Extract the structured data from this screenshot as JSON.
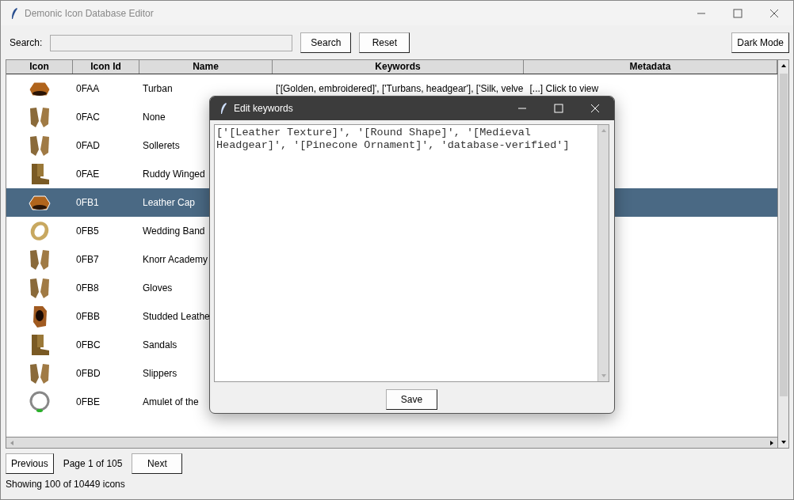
{
  "window": {
    "title": "Demonic Icon Database Editor"
  },
  "toolbar": {
    "search_label": "Search:",
    "search_button": "Search",
    "reset_button": "Reset",
    "dark_mode_button": "Dark Mode"
  },
  "table": {
    "columns": [
      "Icon",
      "Icon Id",
      "Name",
      "Keywords",
      "Metadata"
    ],
    "rows": [
      {
        "kind": "hat",
        "icon_id": "0FAA",
        "name": "Turban",
        "keywords": "['[Golden, embroidered]', ['Turbans, headgear'], ['Silk, velve",
        "keywords_link": "[...] Click to view",
        "selected": false
      },
      {
        "kind": "gloves",
        "icon_id": "0FAC",
        "name": "None",
        "selected": false
      },
      {
        "kind": "gloves",
        "icon_id": "0FAD",
        "name": "Sollerets",
        "selected": false
      },
      {
        "kind": "boots",
        "icon_id": "0FAE",
        "name": "Ruddy Winged",
        "selected": false
      },
      {
        "kind": "hat",
        "icon_id": "0FB1",
        "name": "Leather Cap",
        "selected": true
      },
      {
        "kind": "ring",
        "icon_id": "0FB5",
        "name": "Wedding Band",
        "selected": false
      },
      {
        "kind": "gloves",
        "icon_id": "0FB7",
        "name": "Knorr Academy",
        "selected": false
      },
      {
        "kind": "gloves",
        "icon_id": "0FB8",
        "name": "Gloves",
        "selected": false
      },
      {
        "kind": "vest",
        "icon_id": "0FBB",
        "name": "Studded Leathe",
        "selected": false
      },
      {
        "kind": "boots",
        "icon_id": "0FBC",
        "name": "Sandals",
        "selected": false
      },
      {
        "kind": "gloves",
        "icon_id": "0FBD",
        "name": "Slippers",
        "selected": false
      },
      {
        "kind": "amulet",
        "icon_id": "0FBE",
        "name": "Amulet of the",
        "selected": false
      }
    ]
  },
  "pagination": {
    "previous": "Previous",
    "page": "Page 1 of 105",
    "next": "Next"
  },
  "status_bar": "Showing 100 of 10449 icons",
  "dialog": {
    "title": "Edit keywords",
    "text": "['[Leather Texture]', '[Round Shape]', '[Medieval Headgear]', '[Pinecone Ornament]', 'database-verified']",
    "save_button": "Save"
  }
}
